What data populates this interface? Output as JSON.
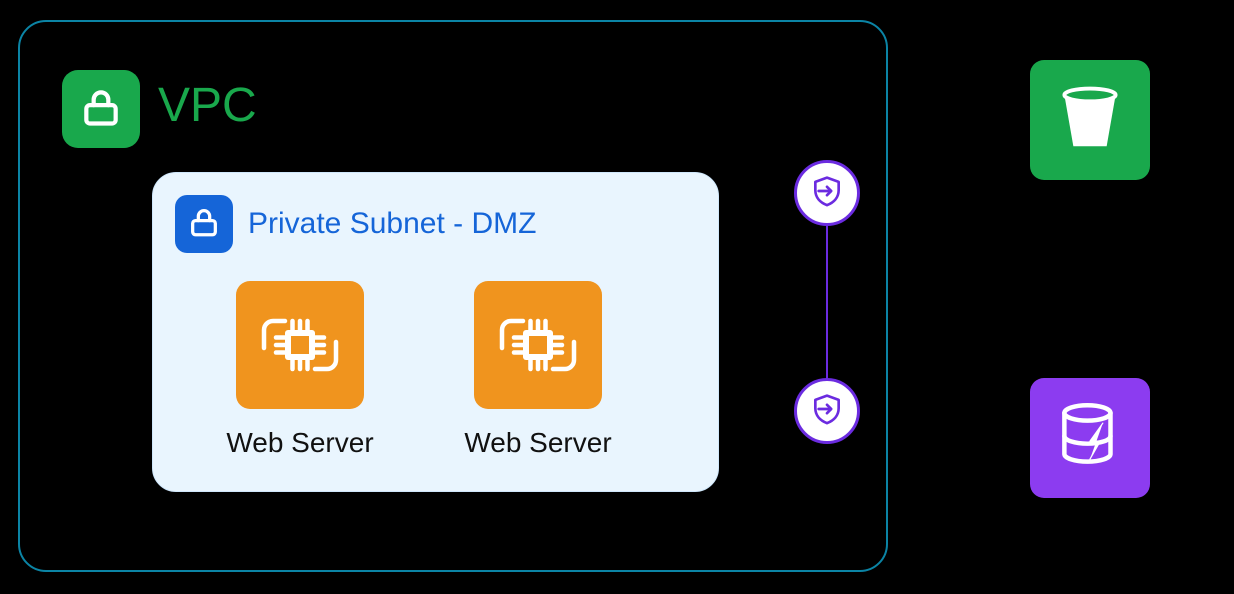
{
  "vpc": {
    "title": "VPC"
  },
  "subnet": {
    "title": "Private Subnet - DMZ",
    "servers": [
      {
        "label": "Web Server"
      },
      {
        "label": "Web Server"
      }
    ]
  },
  "icons": {
    "vpc_badge": "lock-icon",
    "subnet_badge": "lock-icon",
    "server": "compute-icon",
    "endpoint": "vpc-endpoint-icon",
    "storage": "bucket-icon",
    "database": "dynamo-icon"
  },
  "colors": {
    "vpc_border": "#0B84A5",
    "vpc_green": "#19A84C",
    "subnet_blue": "#1565D8",
    "subnet_bg": "#E9F5FE",
    "compute_orange": "#F0941E",
    "endpoint_purple": "#6B2BE0",
    "db_purple": "#8C3CF0"
  }
}
